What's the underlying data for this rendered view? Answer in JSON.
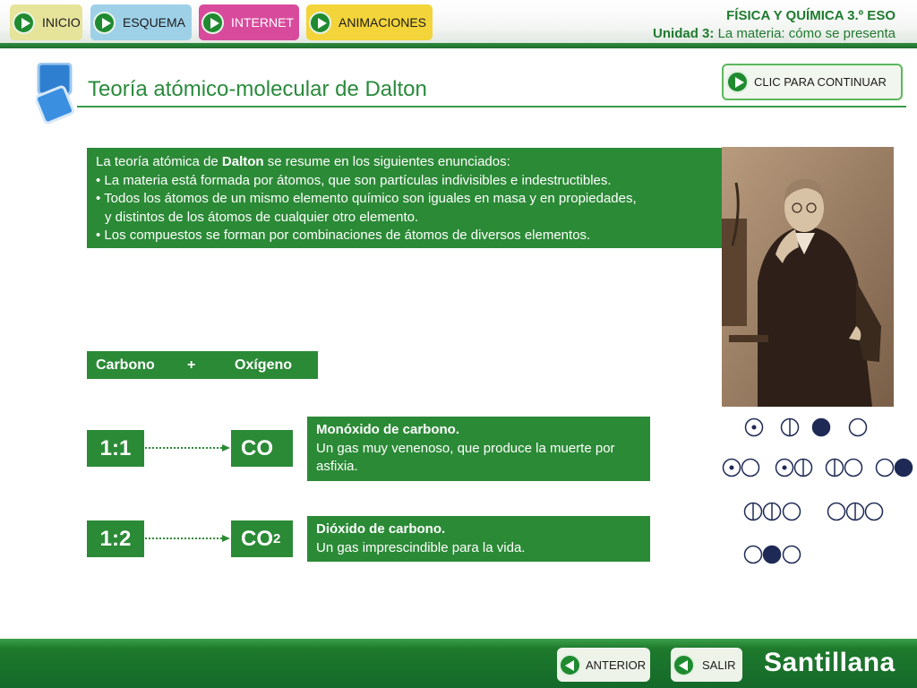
{
  "nav": {
    "inicio": "INICIO",
    "esquema": "ESQUEMA",
    "internet": "INTERNET",
    "animaciones": "ANIMACIONES"
  },
  "course": {
    "title": "FÍSICA Y QUÍMICA 3.º ESO",
    "unit_label": "Unidad 3:",
    "unit_name": "La materia: cómo se presenta"
  },
  "page": {
    "title": "Teoría atómico-molecular de Dalton",
    "continue_label": "CLIC PARA CONTINUAR"
  },
  "intro": {
    "lead_before": "La teoría atómica de ",
    "lead_bold": "Dalton",
    "lead_after": " se resume en los siguientes enunciados:",
    "bullet1": "• La materia está formada por átomos, que son partículas indivisibles e indestructibles.",
    "bullet2a": "• Todos los átomos de un mismo elemento químico son iguales en masa y en propiedades,",
    "bullet2b": "y distintos de los átomos de cualquier otro elemento.",
    "bullet3": "• Los compuestos se forman por combinaciones de átomos de diversos elementos."
  },
  "reaction": {
    "element1": "Carbono",
    "plus": "+",
    "element2": "Oxígeno",
    "rows": [
      {
        "ratio": "1:1",
        "formula": "CO",
        "formula_sub": "",
        "name": "Monóxido de carbono.",
        "description": "Un gas muy venenoso, que produce la muerte por asfixia."
      },
      {
        "ratio": "1:2",
        "formula": "CO",
        "formula_sub": "2",
        "name": "Dióxido de carbono.",
        "description": "Un gas imprescindible para la vida."
      }
    ]
  },
  "footer": {
    "anterior": "ANTERIOR",
    "salir": "SALIR",
    "brand": "Santillana"
  },
  "colors": {
    "accent_green": "#2b8a36",
    "title_green": "#2a8a3c",
    "atom_fill": "#1e2a55"
  }
}
